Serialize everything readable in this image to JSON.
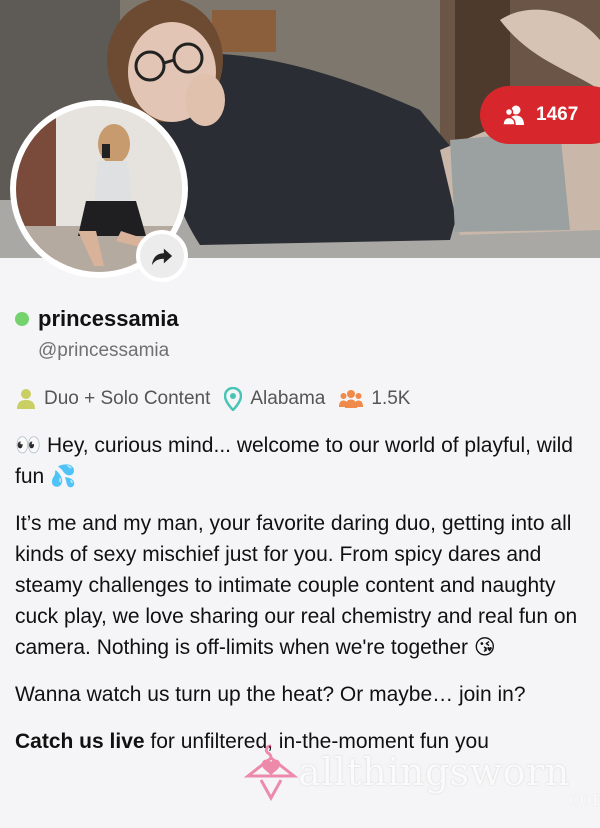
{
  "profile": {
    "display_name": "princessamia",
    "handle": "@princessamia",
    "online": true,
    "followers": "1467"
  },
  "meta": {
    "content_type": "Duo + Solo Content",
    "location": "Alabama",
    "fans": "1.5K"
  },
  "bio": {
    "p1": "👀 Hey, curious mind... welcome to our world of playful, wild fun 💦",
    "p2": "It’s me and my man, your favorite daring duo, getting into all kinds of sexy mischief just for you. From spicy dares and steamy challenges to intimate couple content and naughty cuck play, we love sharing our real chemistry and real fun on camera. Nothing is off-limits when we're together 😘",
    "p3": "Wanna watch us turn up the heat? Or maybe… join in?",
    "p4_bold": "Catch us live",
    "p4_rest": " for unfiltered, in-the-moment fun you"
  },
  "watermark": {
    "text": "allthingsworn",
    "suffix": ".com"
  },
  "colors": {
    "accent_red": "#d7262c",
    "online_green": "#74d36c",
    "location_teal": "#48c4b4",
    "fans_orange": "#f08a4b",
    "content_yellow": "#c9cf62",
    "watermark_pink": "#e8336d"
  },
  "icons": {
    "followers": "users-icon",
    "share": "share-arrow-icon",
    "content_type": "person-icon",
    "location": "map-pin-icon",
    "fans": "group-icon",
    "watermark": "hanger-icon"
  }
}
